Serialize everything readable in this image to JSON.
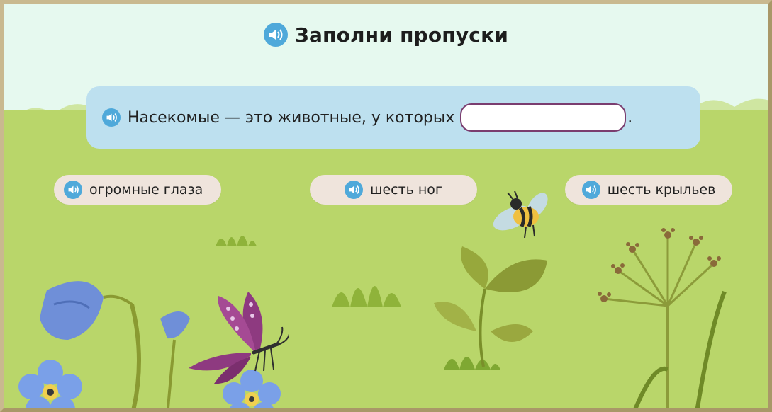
{
  "title": {
    "text": "Заполни пропуски",
    "icon": "speaker-icon"
  },
  "sentence": {
    "text": "Насекомые — это животные, у которых",
    "blank_value": "",
    "end_punct": ".",
    "icon": "speaker-icon"
  },
  "options": [
    {
      "label": "огромные глаза",
      "icon": "speaker-icon"
    },
    {
      "label": "шесть ног",
      "icon": "speaker-icon"
    },
    {
      "label": "шесть крыльев",
      "icon": "speaker-icon"
    }
  ],
  "colors": {
    "speaker": "#4fa9da",
    "card": "#bde0ef",
    "option_bg": "#efe4dc",
    "meadow": "#b9d66a",
    "sky": "#e6f9ef",
    "blank_border": "#7a3d6f"
  }
}
